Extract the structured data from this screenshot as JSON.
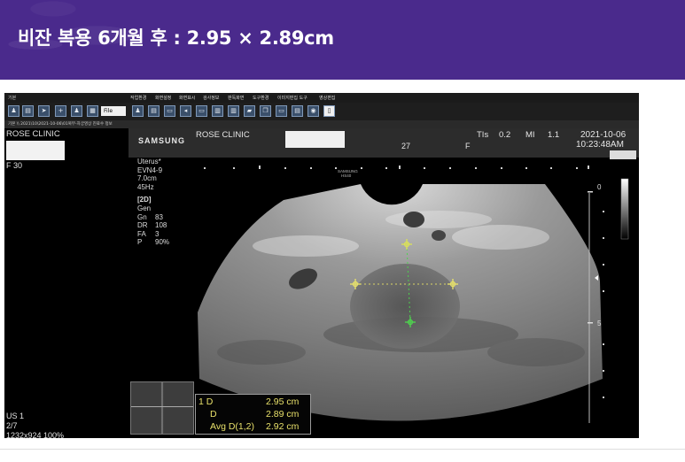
{
  "header": {
    "title": "비잔 복용 6개월 후 : 2.95 × 2.89cm"
  },
  "menubar": {
    "items": [
      "기본",
      "작업환경",
      "화면설정",
      "화면표시",
      "검사정보",
      "판독화면",
      "도구환경",
      "이미지편집 도구",
      "영상편집"
    ]
  },
  "toolbar": {
    "file_label": "File"
  },
  "pathbar": {
    "text": "기본 \\\\ 2021\\10\\2021-10-06\\01복부-자궁영상 진료수 정보"
  },
  "left_panel": {
    "clinic": "ROSE CLINIC",
    "frame": "F 30",
    "us": "US 1",
    "page": "2/7",
    "resolution": "1232x924 100%"
  },
  "ultrasound": {
    "brand": "SAMSUNG",
    "clinic": "ROSE CLINIC",
    "age": "27",
    "sex": "F",
    "tis_label": "TIs",
    "tis_value": "0.2",
    "mi_label": "MI",
    "mi_value": "1.1",
    "date": "2021-10-06",
    "time": "10:23:48AM",
    "probe_watermark": "SAMSUNG\nHS40",
    "params": [
      "Uterus*",
      "EVN4-9",
      "7.0cm",
      "45Hz"
    ],
    "mode": "[2D]",
    "mode_params": [
      {
        "k": "Gen",
        "v": ""
      },
      {
        "k": "Gn",
        "v": "83"
      },
      {
        "k": "DR",
        "v": "108"
      },
      {
        "k": "FA",
        "v": "3"
      },
      {
        "k": "P",
        "v": "90%"
      }
    ],
    "depth_marks": [
      "0",
      "5"
    ]
  },
  "measurements": [
    {
      "label": "1  D",
      "value": "2.95 cm"
    },
    {
      "label": "D",
      "value": "2.89 cm"
    },
    {
      "label": "Avg D(1,2)",
      "value": "2.92 cm"
    }
  ],
  "colors": {
    "header_bg": "#4a2a8c",
    "measurement_text": "#e8e06a",
    "caliper": "#e6e06a",
    "caliper_line2": "#4fd04f"
  }
}
